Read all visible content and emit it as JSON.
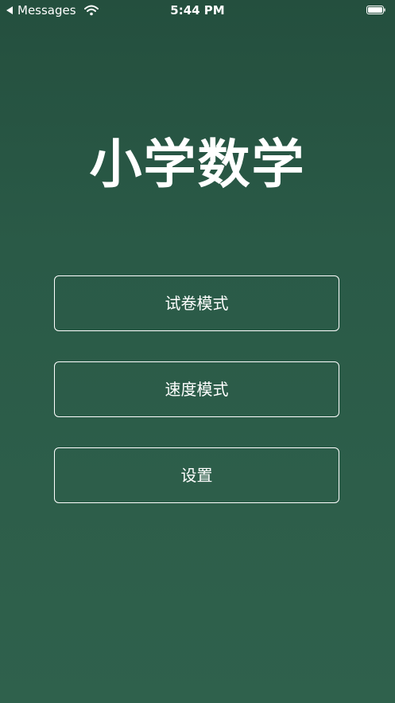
{
  "status_bar": {
    "back_app": "Messages",
    "time": "5:44 PM",
    "icons": {
      "back": "back-arrow-icon",
      "wifi": "wifi-icon",
      "battery": "battery-icon"
    }
  },
  "title": "小学数学",
  "menu": {
    "buttons": [
      {
        "label": "试卷模式"
      },
      {
        "label": "速度模式"
      },
      {
        "label": "设置"
      }
    ]
  },
  "colors": {
    "background": "#2a5a47",
    "text": "#ffffff",
    "button_border": "#ffffff"
  }
}
